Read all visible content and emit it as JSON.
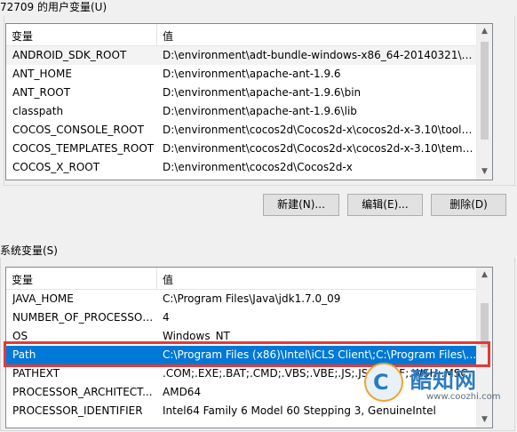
{
  "user_section": {
    "title": "72709 的用户变量(U)",
    "columns": {
      "variable": "变量",
      "value": "值"
    },
    "rows": [
      {
        "variable": "ANDROID_SDK_ROOT",
        "value": "D:\\environment\\adt-bundle-windows-x86_64-20140321\\sdk"
      },
      {
        "variable": "ANT_HOME",
        "value": "D:\\environment\\apache-ant-1.9.6"
      },
      {
        "variable": "ANT_ROOT",
        "value": "D:\\environment\\apache-ant-1.9.6\\bin"
      },
      {
        "variable": "classpath",
        "value": "D:\\environment\\apache-ant-1.9.6\\lib"
      },
      {
        "variable": "COCOS_CONSOLE_ROOT",
        "value": "D:\\environment\\cocos2d\\Cocos2d-x\\cocos2d-x-3.10\\tools\\co..."
      },
      {
        "variable": "COCOS_TEMPLATES_ROOT",
        "value": "D:\\environment\\cocos2d\\Cocos2d-x\\cocos2d-x-3.10\\templates"
      },
      {
        "variable": "COCOS_X_ROOT",
        "value": "D:\\environment\\cocos2d\\Cocos2d-x"
      }
    ],
    "buttons": {
      "new": "新建(N)...",
      "edit": "编辑(E)...",
      "delete": "删除(D)"
    }
  },
  "system_section": {
    "title": "系统变量(S)",
    "columns": {
      "variable": "变量",
      "value": "值"
    },
    "rows": [
      {
        "variable": "JAVA_HOME",
        "value": "C:\\Program Files\\Java\\jdk1.7.0_09"
      },
      {
        "variable": "NUMBER_OF_PROCESSORS",
        "value": "4"
      },
      {
        "variable": "OS",
        "value": "Windows_NT"
      },
      {
        "variable": "Path",
        "value": "C:\\Program Files (x86)\\Intel\\iCLS Client\\;C:\\Program Files\\Intel..."
      },
      {
        "variable": "PATHEXT",
        "value": ".COM;.EXE;.BAT;.CMD;.VBS;.VBE;.JS;.JSE;.WSF;.WSH;.MSC"
      },
      {
        "variable": "PROCESSOR_ARCHITECT...",
        "value": "AMD64"
      },
      {
        "variable": "PROCESSOR_IDENTIFIER",
        "value": "Intel64 Family 6 Model 60 Stepping 3, GenuineIntel"
      }
    ]
  },
  "watermark": {
    "logo_letter": "C",
    "title": "酷知网",
    "subtitle": "www.coozhi.com"
  },
  "colors": {
    "selection": "#0078d7",
    "annotation": "#e53935"
  }
}
